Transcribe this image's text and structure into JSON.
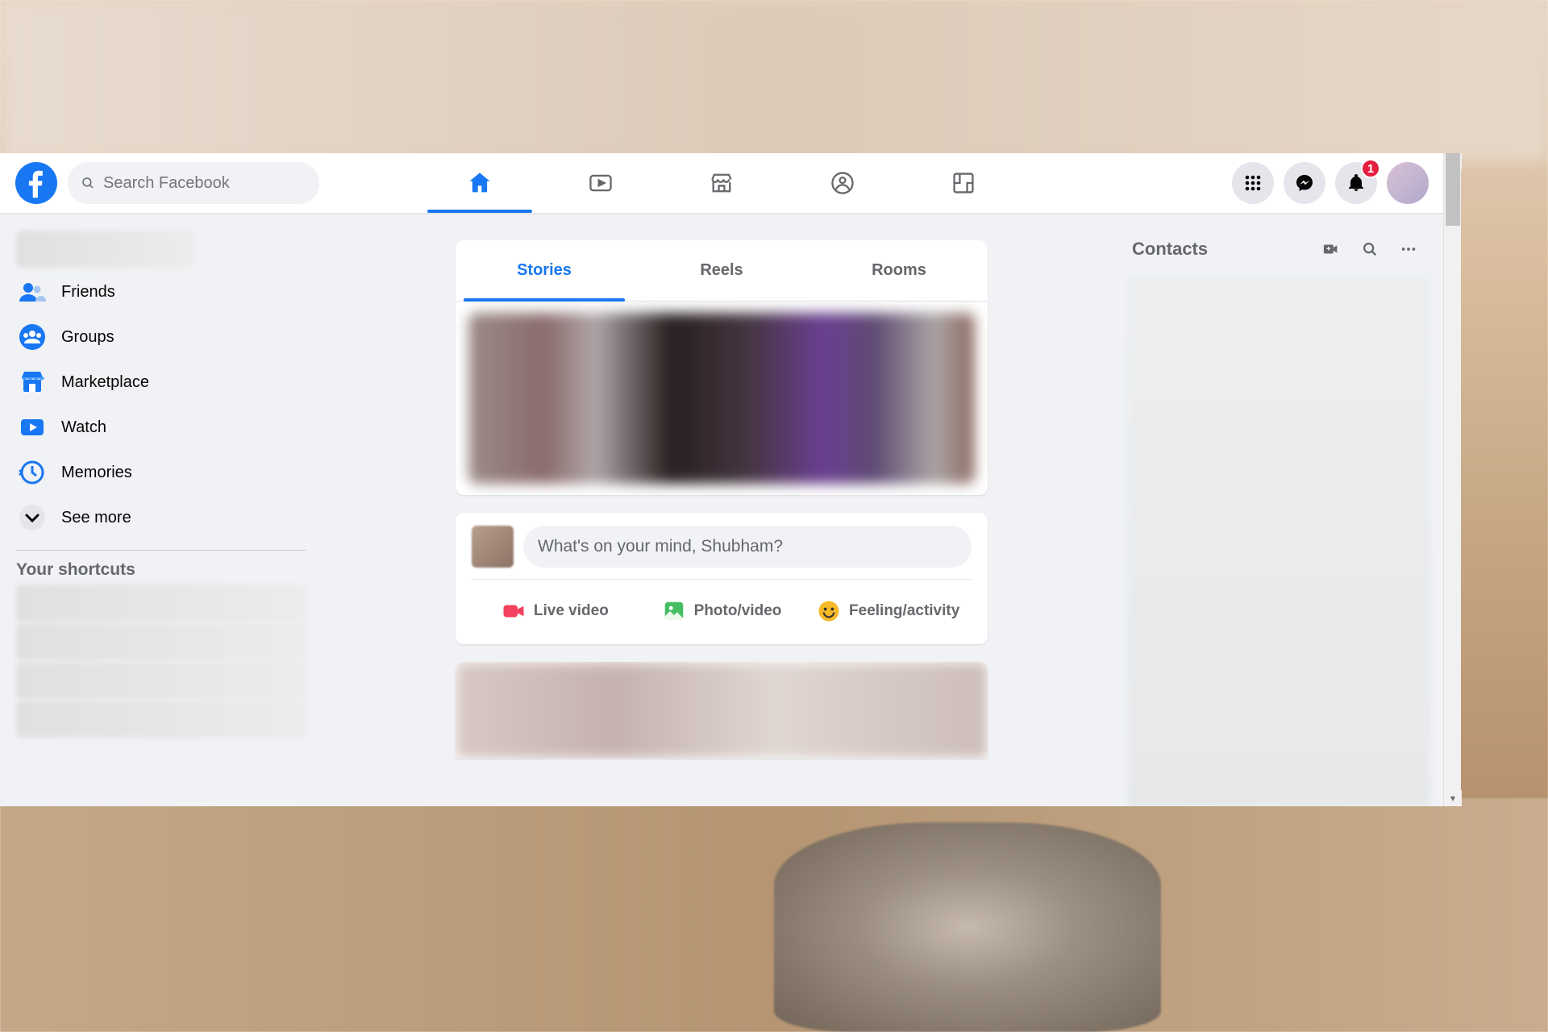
{
  "search": {
    "placeholder": "Search Facebook"
  },
  "left": {
    "friends": "Friends",
    "groups": "Groups",
    "marketplace": "Marketplace",
    "watch": "Watch",
    "memories": "Memories",
    "seemore": "See more",
    "shortcuts_title": "Your shortcuts"
  },
  "tabs": {
    "stories": "Stories",
    "reels": "Reels",
    "rooms": "Rooms"
  },
  "composer": {
    "prompt": "What's on your mind, Shubham?",
    "live": "Live video",
    "photo": "Photo/video",
    "feeling": "Feeling/activity"
  },
  "right": {
    "contacts": "Contacts"
  },
  "notif_badge": "1"
}
